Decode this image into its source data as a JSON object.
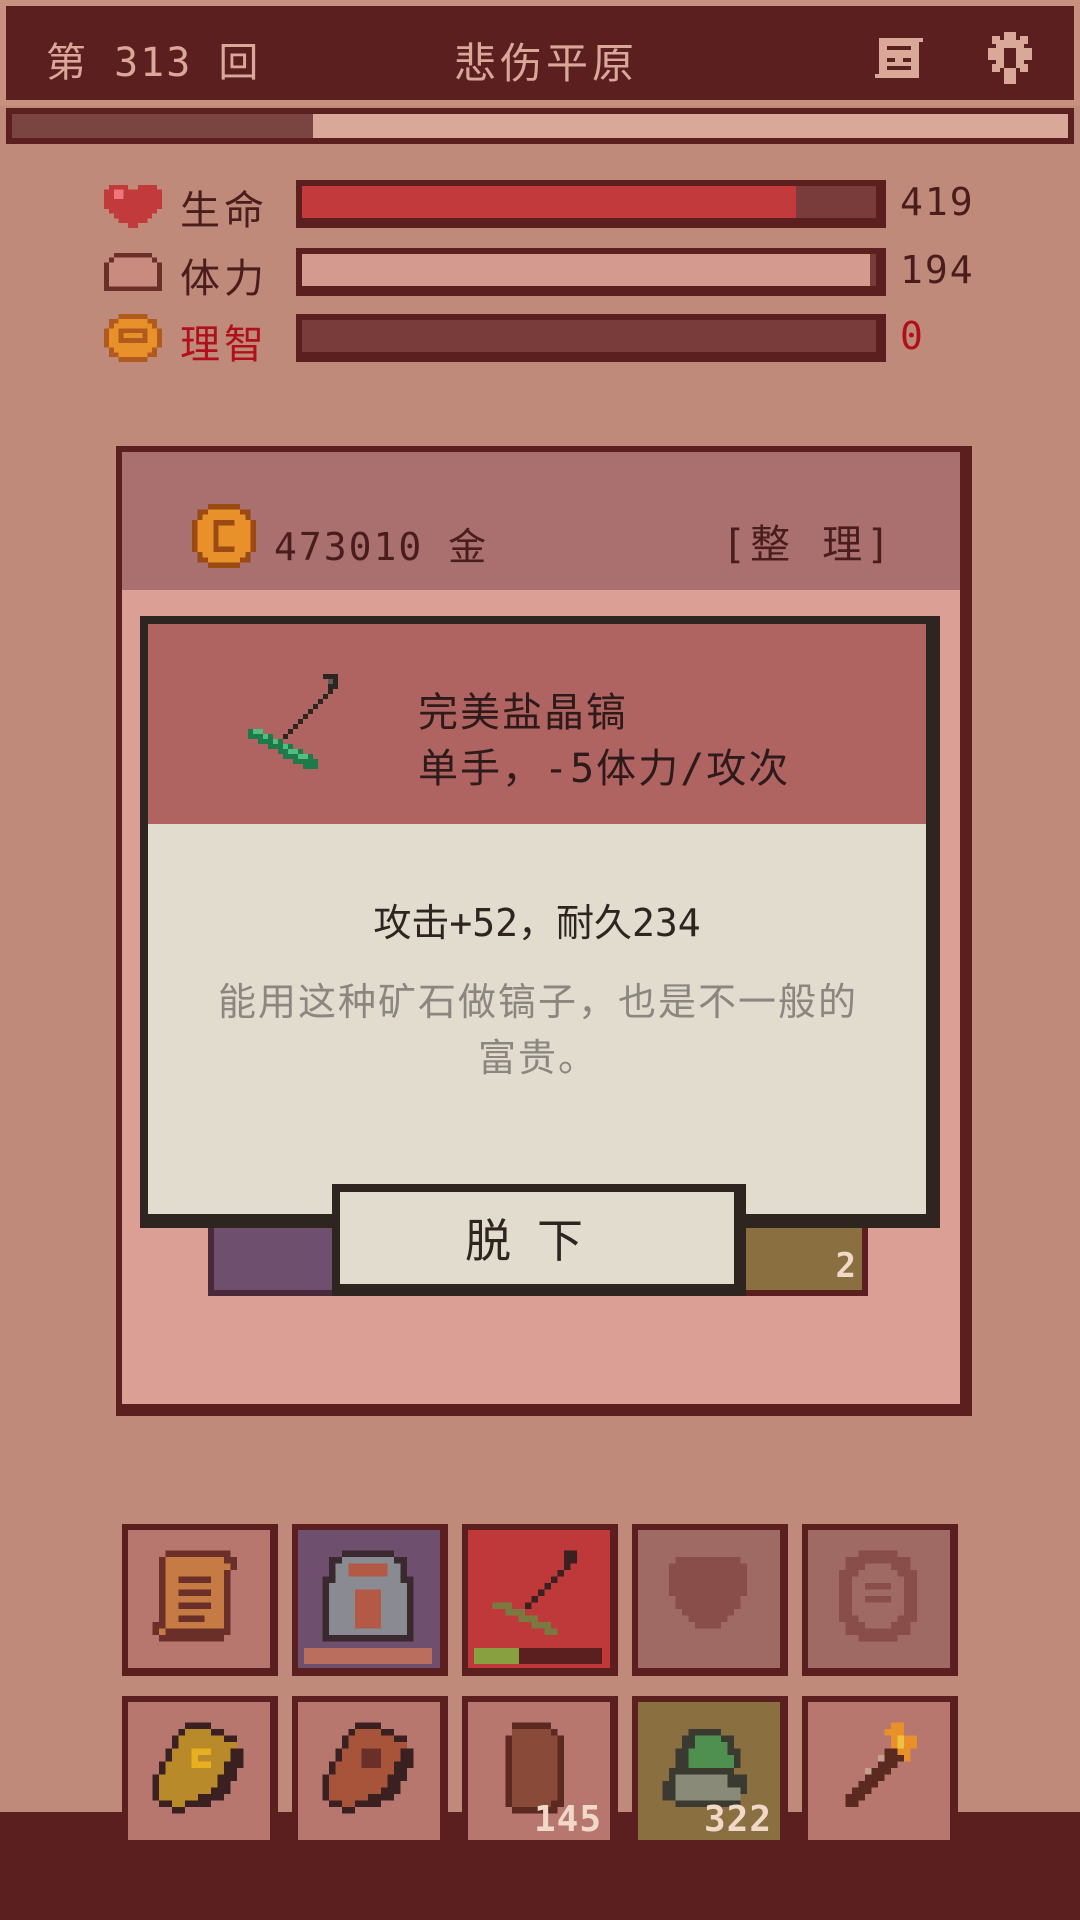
{
  "header": {
    "round_label": "第 313 回",
    "location": "悲伤平原",
    "map_icon": "map-icon",
    "settings_icon": "gear-icon"
  },
  "progress": {
    "fraction": 0.285
  },
  "stats": [
    {
      "key": "life",
      "label": "生命",
      "value": "419",
      "fraction": 0.86,
      "color": "#c23a3c",
      "label_color": "#4a1d1d",
      "value_color": "#4a1d1d",
      "icon": "heart-icon"
    },
    {
      "key": "stamina",
      "label": "体力",
      "value": "194",
      "fraction": 0.99,
      "color": "#d49a90",
      "label_color": "#4a1d1d",
      "value_color": "#4a1d1d",
      "icon": "bread-icon"
    },
    {
      "key": "sanity",
      "label": "理智",
      "value": "0",
      "fraction": 0.0,
      "color": "#7a3c3a",
      "label_color": "#b0101a",
      "value_color": "#b0101a",
      "icon": "brain-icon"
    }
  ],
  "inventory": {
    "gold": "473010 金",
    "sort_label": "[整 理]",
    "partial_slot_count": "2"
  },
  "tooltip": {
    "name": "完美盐晶镐",
    "subtitle": "单手，-5体力/攻次",
    "stats": "攻击+52，耐久234",
    "description": "能用这种矿石做镐子，也是不一般的富贵。",
    "unequip_label": "脱下",
    "icon": "pickaxe-icon"
  },
  "equipment_slots": [
    {
      "name": "scroll-slot",
      "icon": "scroll-icon",
      "bg": "#b7776e",
      "count": ""
    },
    {
      "name": "armor-slot",
      "icon": "armor-icon",
      "bg": "#6e4f6e",
      "count": "",
      "durability": 1.0,
      "dur_color": "#b96e5e"
    },
    {
      "name": "weapon-slot",
      "icon": "pickaxe-icon",
      "bg": "#c0393a",
      "count": "",
      "durability": 0.35,
      "dur_color": "#88a040"
    },
    {
      "name": "shield-slot",
      "icon": "shield-icon",
      "bg": "#a06a64",
      "count": ""
    },
    {
      "name": "ring-slot",
      "icon": "ring-icon",
      "bg": "#a06a64",
      "count": ""
    }
  ],
  "item_slots": [
    {
      "name": "spellbook-slot",
      "icon": "spellbook-icon",
      "bg": "#b7776e",
      "count": ""
    },
    {
      "name": "tome-slot",
      "icon": "tome-icon",
      "bg": "#b7776e",
      "count": ""
    },
    {
      "name": "bread-slot",
      "icon": "bread-icon",
      "bg": "#b7776e",
      "count": "145"
    },
    {
      "name": "ore-slot",
      "icon": "ore-icon",
      "bg": "#8a7040",
      "count": "322"
    },
    {
      "name": "torch-slot",
      "icon": "torch-icon",
      "bg": "#b7776e",
      "count": ""
    }
  ]
}
